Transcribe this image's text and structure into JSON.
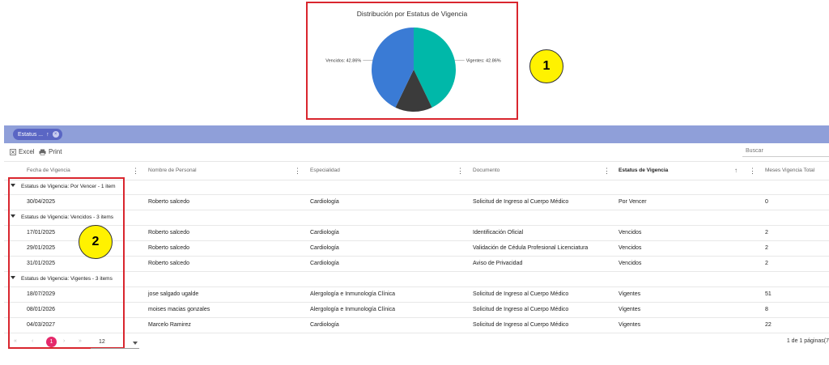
{
  "chart_data": {
    "type": "pie",
    "title": "Distribución por Estatus de Vigencia",
    "slices": [
      {
        "label": "Vigentes",
        "value": 42.86,
        "color": "#00b8a9",
        "display": "Vigentes: 42.86%"
      },
      {
        "label": "Por Vencer",
        "value": 14.28,
        "color": "#3b3b3b",
        "display": ""
      },
      {
        "label": "Vencidos",
        "value": 42.86,
        "color": "#3a7bd5",
        "display": "Vencidos: 42.86%"
      }
    ]
  },
  "callouts": {
    "one": "1",
    "two": "2"
  },
  "group_bar": {
    "chip_label": "Estatus ...",
    "chip_arrow": "↑",
    "chip_close": "×"
  },
  "toolbar": {
    "excel": "Excel",
    "print": "Print",
    "search_placeholder": "Buscar"
  },
  "columns": {
    "fecha": "Fecha de Vigencia",
    "nombre": "Nombre de Personal",
    "especialidad": "Especialidad",
    "documento": "Documento",
    "estatus": "Estatus de Vigencia",
    "sort_arrow": "↑",
    "meses": "Meses Vigencia Total",
    "menu": "⋮"
  },
  "groups": [
    {
      "label": "Estatus de Vigencia: Por Vencer - 1 item",
      "rows": [
        {
          "fecha": "30/04/2025",
          "nombre": "Roberto salcedo",
          "especialidad": "Cardiología",
          "documento": "Solicitud de Ingreso al Cuerpo Médico",
          "estatus": "Por Vencer",
          "meses": "0"
        }
      ]
    },
    {
      "label": "Estatus de Vigencia: Vencidos - 3 items",
      "rows": [
        {
          "fecha": "17/01/2025",
          "nombre": "Roberto salcedo",
          "especialidad": "Cardiología",
          "documento": "Identificación Oficial",
          "estatus": "Vencidos",
          "meses": "2"
        },
        {
          "fecha": "29/01/2025",
          "nombre": "Roberto salcedo",
          "especialidad": "Cardiología",
          "documento": "Validación de Cédula Profesional Licenciatura",
          "estatus": "Vencidos",
          "meses": "2"
        },
        {
          "fecha": "31/01/2025",
          "nombre": "Roberto salcedo",
          "especialidad": "Cardiología",
          "documento": "Aviso de Privacidad",
          "estatus": "Vencidos",
          "meses": "2"
        }
      ]
    },
    {
      "label": "Estatus de Vigencia: Vigentes - 3 items",
      "rows": [
        {
          "fecha": "18/07/2029",
          "nombre": "jose salgado ugalde",
          "especialidad": "Alergología e Inmunología Clínica",
          "documento": "Solicitud de Ingreso al Cuerpo Médico",
          "estatus": "Vigentes",
          "meses": "51"
        },
        {
          "fecha": "08/01/2026",
          "nombre": "moises macias gonzales",
          "especialidad": "Alergología e Inmunología Clínica",
          "documento": "Solicitud de Ingreso al Cuerpo Médico",
          "estatus": "Vigentes",
          "meses": "8"
        },
        {
          "fecha": "04/03/2027",
          "nombre": "Marcelo Ramirez",
          "especialidad": "Cardiología",
          "documento": "Solicitud de Ingreso al Cuerpo Médico",
          "estatus": "Vigentes",
          "meses": "22"
        }
      ]
    }
  ],
  "pager": {
    "first": "«",
    "prev": "‹",
    "current": "1",
    "next": "›",
    "last": "»",
    "page_size": "12",
    "info": "1 de 1 páginas(7"
  }
}
